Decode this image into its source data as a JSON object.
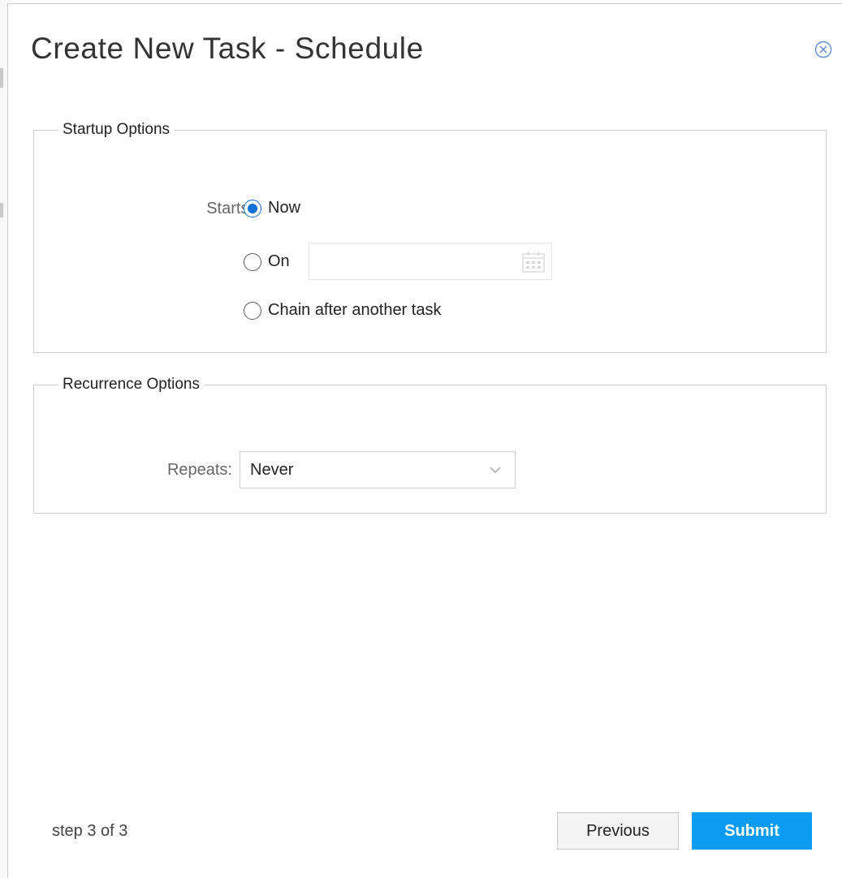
{
  "dialog": {
    "title": "Create New Task - Schedule"
  },
  "startup": {
    "legend": "Startup Options",
    "starts_label": "Starts:",
    "options": [
      {
        "label": "Now",
        "checked": true
      },
      {
        "label": "On",
        "checked": false
      },
      {
        "label": "Chain after another task",
        "checked": false
      }
    ],
    "date_value": ""
  },
  "recurrence": {
    "legend": "Recurrence Options",
    "repeats_label": "Repeats:",
    "repeats_value": "Never"
  },
  "footer": {
    "step_text": "step 3 of 3",
    "previous_label": "Previous",
    "submit_label": "Submit"
  },
  "colors": {
    "accent": "#0a6fd8",
    "submit_bg": "#0b9bf0",
    "close_icon": "#5b8ed6"
  },
  "icons": {
    "close": "circle-x-icon",
    "calendar": "calendar-icon",
    "dropdown": "chevron-down-icon"
  }
}
